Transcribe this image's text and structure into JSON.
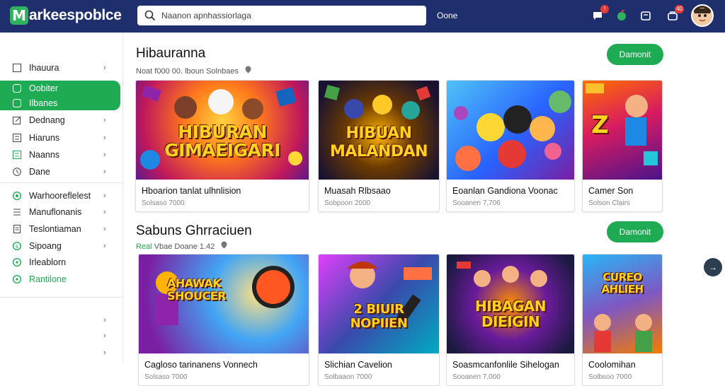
{
  "header": {
    "logo_letter": "M",
    "logo_text": "arkeespoblce",
    "search_placeholder": "Naanon apnhassiorlaga",
    "link": "Oone",
    "icons": [
      {
        "name": "chat-icon",
        "badge": "!"
      },
      {
        "name": "apple-icon",
        "badge": ""
      },
      {
        "name": "cart-icon",
        "badge": ""
      },
      {
        "name": "bag-icon",
        "badge": "40"
      }
    ]
  },
  "sidebar": {
    "items": [
      {
        "label": "Ihauura",
        "icon": "square-icon",
        "chevron": "›"
      },
      {
        "label": "Oobiter",
        "icon": "square-icon",
        "chevron": ""
      },
      {
        "label": "Ilbanes",
        "icon": "square-icon",
        "chevron": ""
      },
      {
        "label": "Dednang",
        "icon": "pencil-icon",
        "chevron": "›"
      },
      {
        "label": "Hiaruns",
        "icon": "list-icon",
        "chevron": "›"
      },
      {
        "label": "Naanns",
        "icon": "grid-icon",
        "chevron": "›"
      },
      {
        "label": "Dane",
        "icon": "clock-icon",
        "chevron": "›"
      },
      {
        "label": "Warhooreflelest",
        "icon": "leaf-icon",
        "chevron": "›"
      },
      {
        "label": "Manuflonanis",
        "icon": "list-icon",
        "chevron": "›"
      },
      {
        "label": "Teslontiaman",
        "icon": "document-icon",
        "chevron": "›"
      },
      {
        "label": "Sipoang",
        "icon": "circle-icon",
        "chevron": "›"
      },
      {
        "label": "Irleablorn",
        "icon": "circle-icon",
        "chevron": ""
      },
      {
        "label": "Rantilone",
        "icon": "circle-icon",
        "chevron": ""
      }
    ],
    "extra_chevrons": [
      "›",
      "›",
      "›"
    ]
  },
  "sections": [
    {
      "title": "Hibauranna",
      "meta_prefix": "",
      "meta": "Noat f000 00. lboun Solnbaes",
      "button": "Damonit",
      "cards": [
        {
          "thumb_title": "HIBURAN\nGIMAEIGARI",
          "name": "Hboarion tanlat ulhnlision",
          "sub": "Solsaso 7000"
        },
        {
          "thumb_title": "HIBUAN\nMALANDAN",
          "name": "Muasah Rlbsaao",
          "sub": "Sobpoon 2000"
        },
        {
          "thumb_title": "",
          "name": "Eoanlan Gandiona Voonac",
          "sub": "Sooanen 7,706"
        },
        {
          "thumb_title": "Z",
          "name": "Camer Son",
          "sub": "Solson Clairs"
        }
      ]
    },
    {
      "title": "Sabuns Ghrraciuen",
      "meta_prefix": "Real",
      "meta": "Vbae Doane 1.42",
      "button": "Damonit",
      "cards": [
        {
          "thumb_title": "AHAWAK\nSHOUCER",
          "name": "Cagloso tarinanens Vonnech",
          "sub": "Solsaso 7000"
        },
        {
          "thumb_title": "2 BIUIR\nNOPIIEN",
          "name": "Slichian Cavelion",
          "sub": "Solbaaon 7000"
        },
        {
          "thumb_title": "HIBAGAN\nDIEIGIN",
          "name": "Soasmcanfonlile Sihelogan",
          "sub": "Sooanen 7,000"
        },
        {
          "thumb_title": "CUREO\nAHLIEH",
          "name": "Coolomihan",
          "sub": "Solbsoo 7000"
        }
      ]
    }
  ],
  "fab_label": "→"
}
